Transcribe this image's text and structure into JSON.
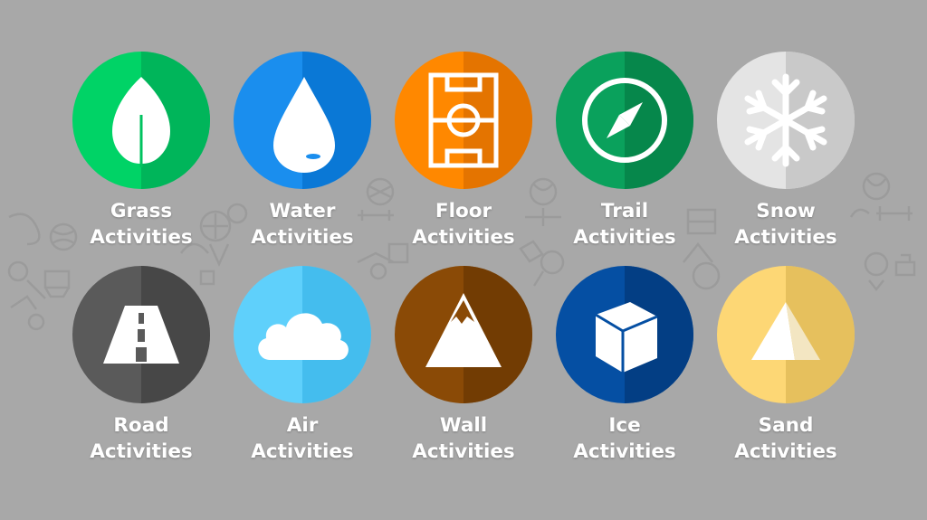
{
  "tiles": [
    {
      "id": "grass",
      "line1": "Grass",
      "line2": "Activities",
      "color": "#00d366",
      "shade": "#00b55a",
      "icon": "leaf-icon"
    },
    {
      "id": "water",
      "line1": "Water",
      "line2": "Activities",
      "color": "#1a8eee",
      "shade": "#0a78d6",
      "icon": "water-drop-icon"
    },
    {
      "id": "floor",
      "line1": "Floor",
      "line2": "Activities",
      "color": "#ff8800",
      "shade": "#e47400",
      "icon": "court-icon"
    },
    {
      "id": "trail",
      "line1": "Trail",
      "line2": "Activities",
      "color": "#0aa15c",
      "shade": "#06874b",
      "icon": "compass-icon"
    },
    {
      "id": "snow",
      "line1": "Snow",
      "line2": "Activities",
      "color": "#e4e4e4",
      "shade": "#c9c9c9",
      "icon": "snowflake-icon"
    },
    {
      "id": "road",
      "line1": "Road",
      "line2": "Activities",
      "color": "#5a5a5a",
      "shade": "#474747",
      "icon": "road-icon"
    },
    {
      "id": "air",
      "line1": "Air",
      "line2": "Activities",
      "color": "#5fd0fb",
      "shade": "#44bdee",
      "icon": "cloud-icon"
    },
    {
      "id": "wall",
      "line1": "Wall",
      "line2": "Activities",
      "color": "#8a4a06",
      "shade": "#723c03",
      "icon": "mountain-icon"
    },
    {
      "id": "ice",
      "line1": "Ice",
      "line2": "Activities",
      "color": "#054fa3",
      "shade": "#033e84",
      "icon": "ice-cube-icon"
    },
    {
      "id": "sand",
      "line1": "Sand",
      "line2": "Activities",
      "color": "#fdd775",
      "shade": "#e6c05d",
      "icon": "pyramid-icon"
    }
  ]
}
